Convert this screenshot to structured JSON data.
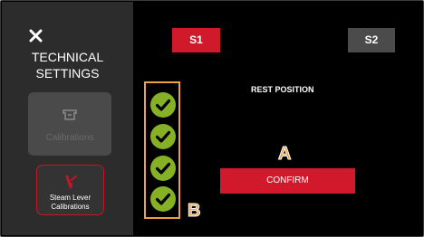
{
  "sidebar": {
    "title_line1": "TECHNICAL",
    "title_line2": "SETTINGS",
    "calibrations_label": "Calibrations",
    "steam_label_line1": "Steam Lever",
    "steam_label_line2": "Calibrations"
  },
  "main": {
    "tab_s1": "S1",
    "tab_s2": "S2",
    "heading": "REST POSITION",
    "confirm_label": "CONFIRM",
    "annotation_a": "A",
    "annotation_b": "B",
    "check_count": 4
  },
  "colors": {
    "accent_red": "#d0192b",
    "check_green": "#87b124",
    "annotation_orange": "#f0a23a",
    "sidebar_bg": "#2c2c2c"
  },
  "icons": [
    "close-icon",
    "calibration-icon",
    "steam-lever-icon",
    "checkmark-icon"
  ]
}
